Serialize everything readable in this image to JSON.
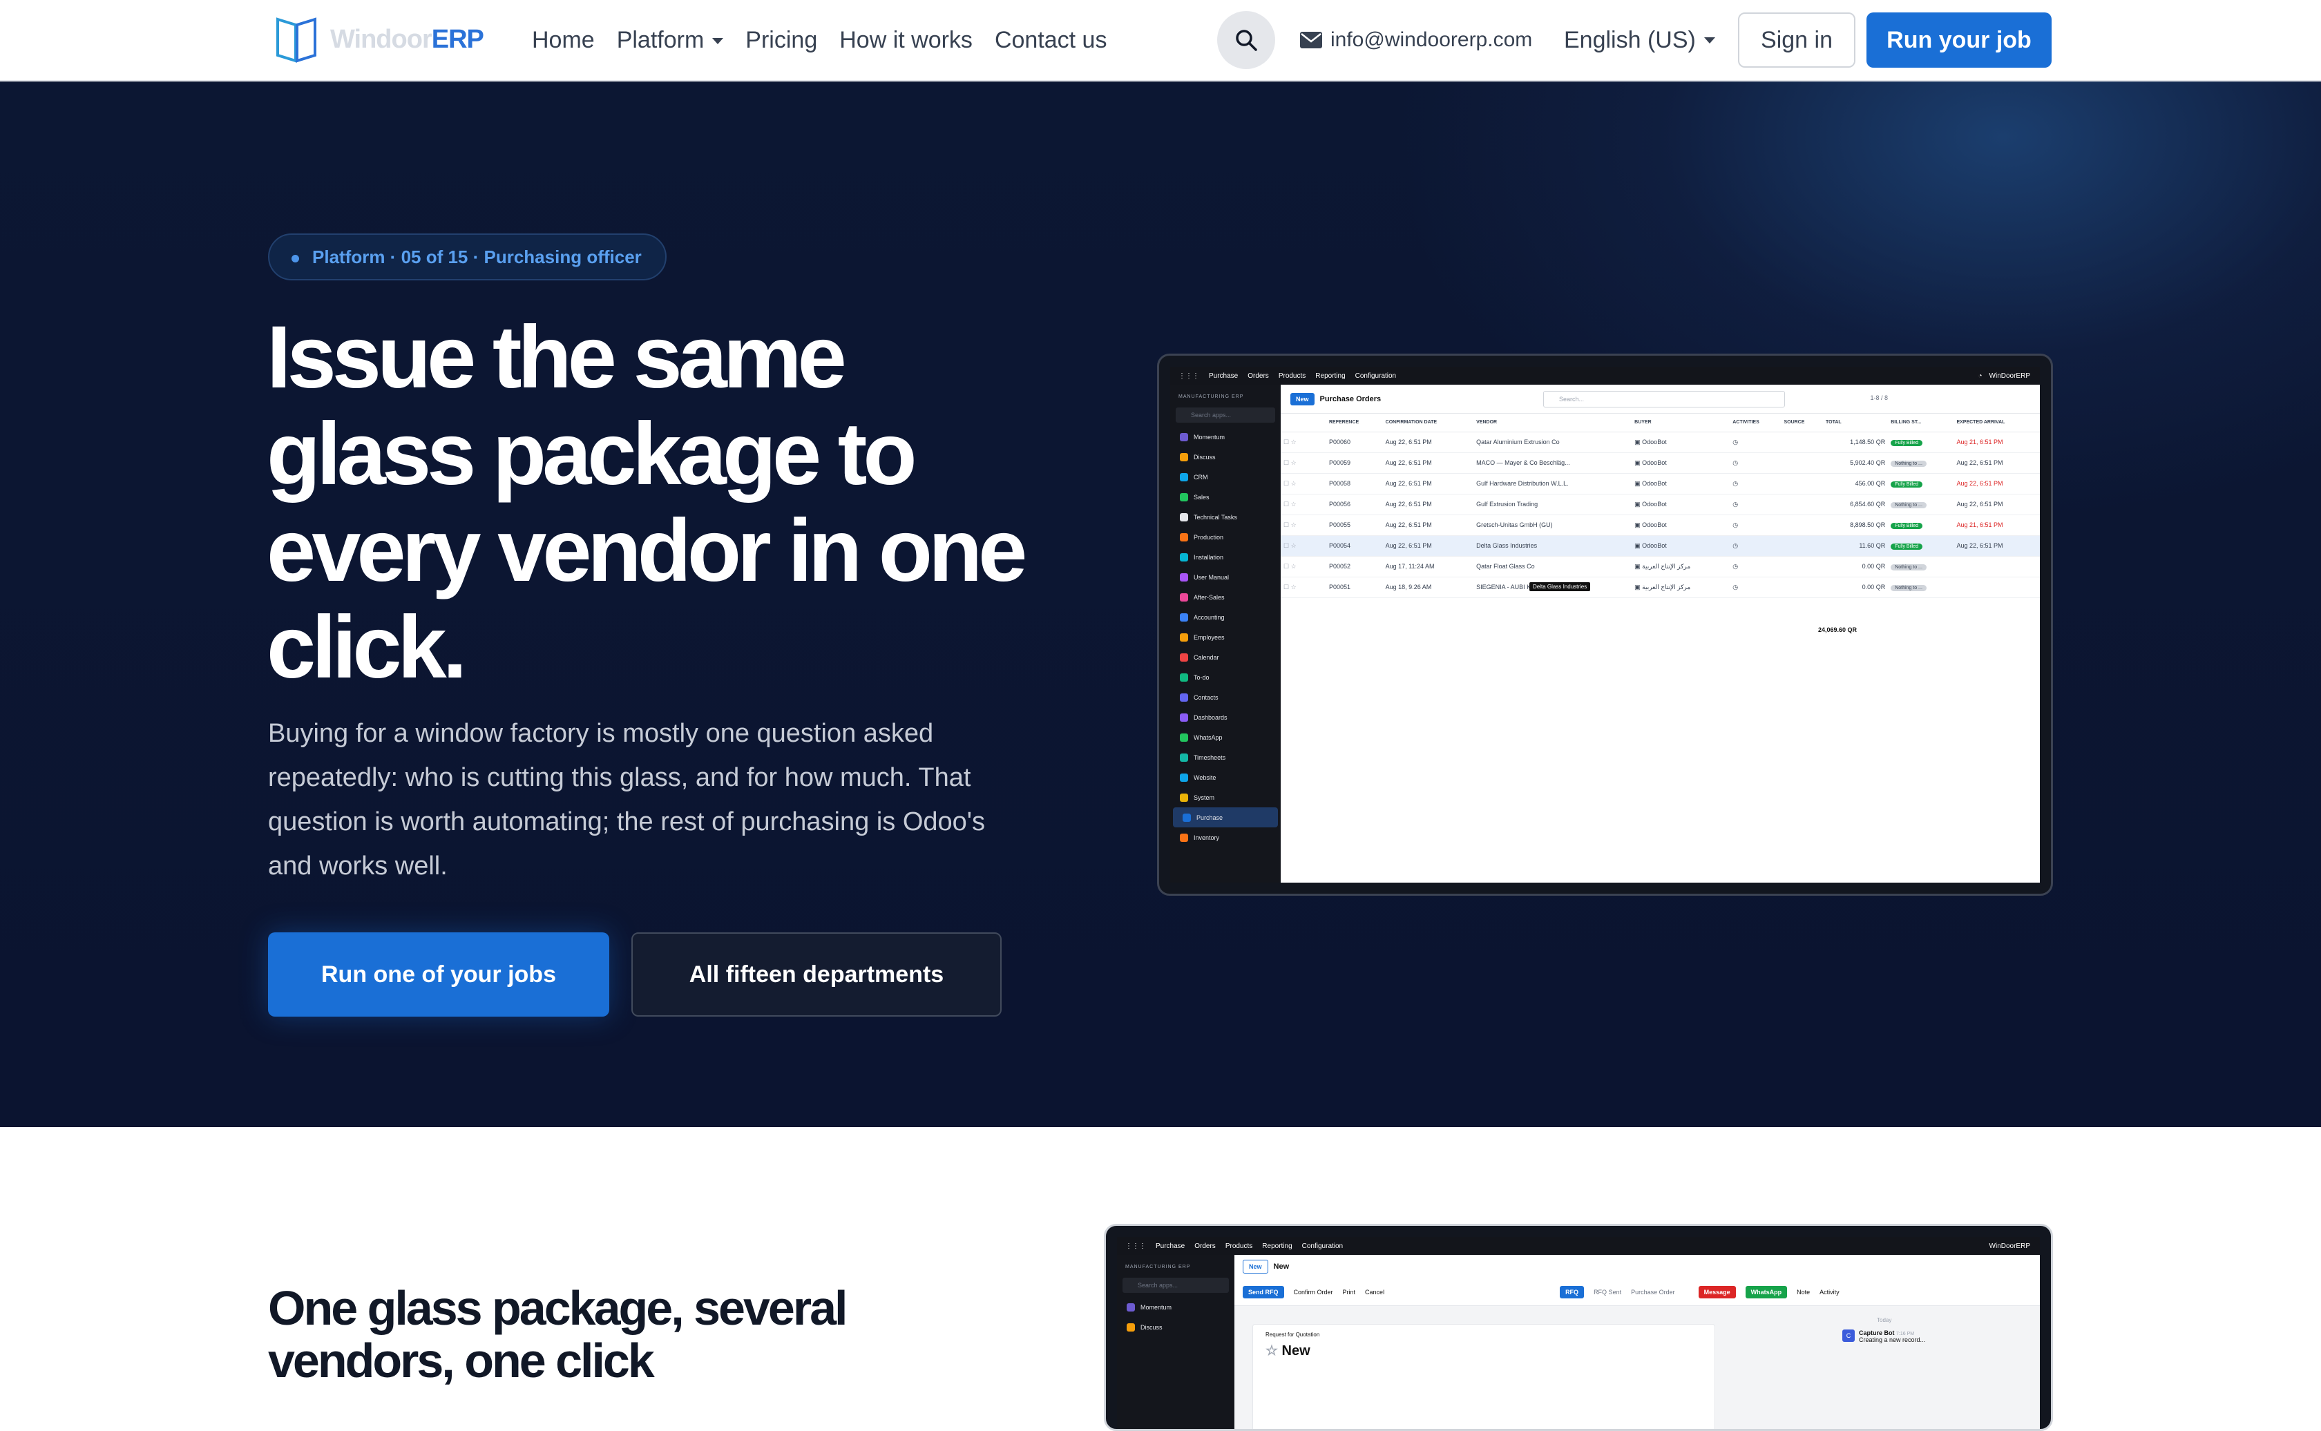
{
  "nav": {
    "logo_light": "Windoor",
    "logo_bold": "ERP",
    "links": [
      "Home",
      "Platform",
      "Pricing",
      "How it works",
      "Contact us"
    ],
    "email": "info@windoorerp.com",
    "language": "English (US)",
    "signin": "Sign in",
    "cta": "Run your job"
  },
  "hero": {
    "badge": "Platform · 05 of 15 · Purchasing officer",
    "title": "Issue the same glass package to every vendor in one click.",
    "lead": "Buying for a window factory is mostly one question asked repeatedly: who is cutting this glass, and for how much. That question is worth automating; the rest of purchasing is Odoo's and works well.",
    "primary_button": "Run one of your jobs",
    "secondary_button": "All fifteen departments"
  },
  "app": {
    "menu": [
      "Purchase",
      "Orders",
      "Products",
      "Reporting",
      "Configuration"
    ],
    "company": "WinDoorERP",
    "sidebar_brand": "MANUFACTURING ERP",
    "search_apps": "Search apps...",
    "sidebar_items": [
      "Momentum",
      "Discuss",
      "CRM",
      "Sales",
      "Technical Tasks",
      "Production",
      "Installation",
      "User Manual",
      "After-Sales",
      "Accounting",
      "Employees",
      "Calendar",
      "To-do",
      "Contacts",
      "Dashboards",
      "WhatsApp",
      "Timesheets",
      "Website",
      "System",
      "Purchase",
      "Inventory"
    ],
    "new_label": "New",
    "list_title": "Purchase Orders",
    "search_placeholder": "Search...",
    "pager": "1-8 / 8",
    "columns": [
      "REFERENCE",
      "CONFIRMATION DATE",
      "VENDOR",
      "BUYER",
      "ACTIVITIES",
      "SOURCE",
      "TOTAL",
      "BILLING ST...",
      "EXPECTED ARRIVAL"
    ],
    "rows": [
      {
        "ref": "P00060",
        "date": "Aug 22, 6:51 PM",
        "vendor": "Qatar Aluminium Extrusion Co",
        "buyer": "OdooBot",
        "total": "1,148.50 QR",
        "billing": "Fully Billed",
        "arrival": "Aug 21, 6:51 PM",
        "late": true
      },
      {
        "ref": "P00059",
        "date": "Aug 22, 6:51 PM",
        "vendor": "MACO — Mayer & Co Beschläg...",
        "buyer": "OdooBot",
        "total": "5,902.40 QR",
        "billing": "Nothing to ...",
        "arrival": "Aug 22, 6:51 PM",
        "late": false
      },
      {
        "ref": "P00058",
        "date": "Aug 22, 6:51 PM",
        "vendor": "Gulf Hardware Distribution W.L.L.",
        "buyer": "OdooBot",
        "total": "456.00 QR",
        "billing": "Fully Billed",
        "arrival": "Aug 22, 6:51 PM",
        "late": true
      },
      {
        "ref": "P00056",
        "date": "Aug 22, 6:51 PM",
        "vendor": "Gulf Extrusion Trading",
        "buyer": "OdooBot",
        "total": "6,854.60 QR",
        "billing": "Nothing to ...",
        "arrival": "Aug 22, 6:51 PM",
        "late": false
      },
      {
        "ref": "P00055",
        "date": "Aug 22, 6:51 PM",
        "vendor": "Gretsch-Unitas GmbH (GU)",
        "buyer": "OdooBot",
        "total": "8,898.50 QR",
        "billing": "Fully Billed",
        "arrival": "Aug 21, 6:51 PM",
        "late": true
      },
      {
        "ref": "P00054",
        "date": "Aug 22, 6:51 PM",
        "vendor": "Delta Glass Industries",
        "buyer": "OdooBot",
        "total": "11.60 QR",
        "billing": "Fully Billed",
        "arrival": "Aug 22, 6:51 PM",
        "late": false
      },
      {
        "ref": "P00052",
        "date": "Aug 17, 11:24 AM",
        "vendor": "Qatar Float Glass Co",
        "buyer": "مركز الإنتاج العربية",
        "total": "0.00 QR",
        "billing": "Nothing to ...",
        "arrival": "",
        "late": false
      },
      {
        "ref": "P00051",
        "date": "Aug 18, 9:26 AM",
        "vendor": "SIEGENIA - AUBI KG",
        "buyer": "مركز الإنتاج العربية",
        "total": "0.00 QR",
        "billing": "Nothing to ...",
        "arrival": "",
        "late": false
      }
    ],
    "sum_total": "24,069.60 QR",
    "tooltip": "Delta Glass Industries"
  },
  "app2": {
    "title_new": "New",
    "buttons": [
      "Send RFQ",
      "Confirm Order",
      "Print",
      "Cancel"
    ],
    "states": [
      "RFQ",
      "RFQ Sent",
      "Purchase Order"
    ],
    "chatter": [
      "Message",
      "WhatsApp",
      "Note",
      "Activity"
    ],
    "rfq_label": "Request for Quotation",
    "today": "Today",
    "bot_name": "Capture Bot",
    "bot_time": "7:16 PM",
    "bot_msg": "Creating a new record..."
  },
  "section2": {
    "title": "One glass package, several vendors, one click"
  },
  "colors": {
    "accent": "#1a6fd6",
    "hero_bg": "#0b1430",
    "success": "#16a34a",
    "late": "#dc2626"
  }
}
